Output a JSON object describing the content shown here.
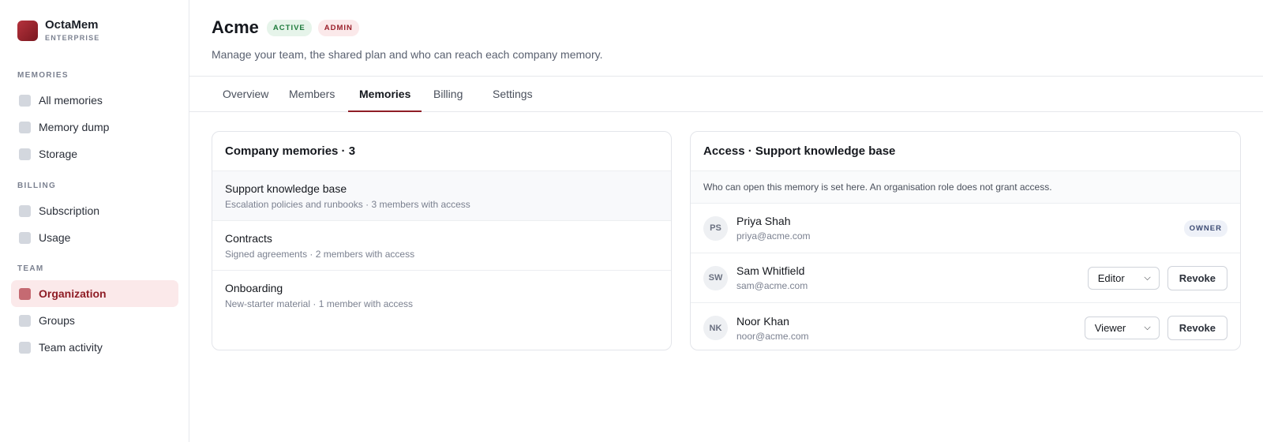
{
  "brand": {
    "name": "OctaMem",
    "tier": "ENTERPRISE"
  },
  "sidebar": {
    "sections": [
      {
        "title": "MEMORIES",
        "items": [
          {
            "label": "All memories"
          },
          {
            "label": "Memory dump"
          },
          {
            "label": "Storage"
          }
        ]
      },
      {
        "title": "BILLING",
        "items": [
          {
            "label": "Subscription"
          },
          {
            "label": "Usage"
          }
        ]
      },
      {
        "title": "TEAM",
        "items": [
          {
            "label": "Organization",
            "active": true
          },
          {
            "label": "Groups"
          },
          {
            "label": "Team activity"
          }
        ]
      }
    ]
  },
  "header": {
    "title": "Acme",
    "status_badge": "ACTIVE",
    "role_badge": "ADMIN",
    "subtitle": "Manage your team, the shared plan and who can reach each company memory."
  },
  "tabs": [
    {
      "label": "Overview"
    },
    {
      "label": "Members"
    },
    {
      "label": "Memories",
      "active": true
    },
    {
      "label": "Billing"
    },
    {
      "label": "Settings"
    }
  ],
  "memories": {
    "title": "Company memories · 3",
    "items": [
      {
        "name": "Support knowledge base",
        "desc": "Escalation policies and runbooks · 3 members with access",
        "selected": true
      },
      {
        "name": "Contracts",
        "desc": "Signed agreements · 2 members with access"
      },
      {
        "name": "Onboarding",
        "desc": "New-starter material · 1 member with access"
      }
    ]
  },
  "access": {
    "title": "Access · Support knowledge base",
    "note": "Who can open this memory is set here. An organisation role does not grant access.",
    "members": [
      {
        "initials": "PS",
        "name": "Priya Shah",
        "email": "priya@acme.com",
        "badge": "OWNER"
      },
      {
        "initials": "SW",
        "name": "Sam Whitfield",
        "email": "sam@acme.com",
        "role": "Editor",
        "action": "Revoke"
      },
      {
        "initials": "NK",
        "name": "Noor Khan",
        "email": "noor@acme.com",
        "role": "Viewer",
        "action": "Revoke"
      }
    ]
  },
  "colors": {
    "accent": "#8f1d26",
    "active_badge": "#1e7a3c",
    "nav_active_bg": "#fbe9ea"
  }
}
